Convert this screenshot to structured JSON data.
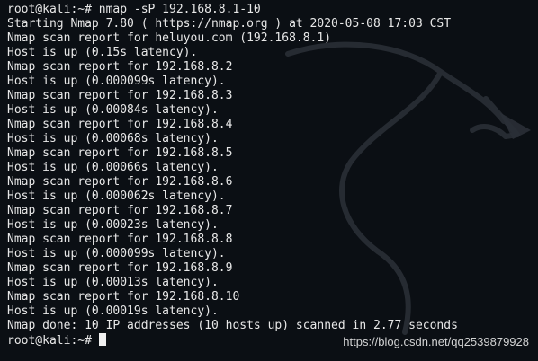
{
  "terminal": {
    "background": "#0b0f14",
    "text_color": "#e8e8e8",
    "lines": [
      "root@kali:~# nmap -sP 192.168.8.1-10",
      "Starting Nmap 7.80 ( https://nmap.org ) at 2020-05-08 17:03 CST",
      "Nmap scan report for heluyou.com (192.168.8.1)",
      "Host is up (0.15s latency).",
      "Nmap scan report for 192.168.8.2",
      "Host is up (0.000099s latency).",
      "Nmap scan report for 192.168.8.3",
      "Host is up (0.00084s latency).",
      "Nmap scan report for 192.168.8.4",
      "Host is up (0.00068s latency).",
      "Nmap scan report for 192.168.8.5",
      "Host is up (0.00066s latency).",
      "Nmap scan report for 192.168.8.6",
      "Host is up (0.000062s latency).",
      "Nmap scan report for 192.168.8.7",
      "Host is up (0.00023s latency).",
      "Nmap scan report for 192.168.8.8",
      "Host is up (0.000099s latency).",
      "Nmap scan report for 192.168.8.9",
      "Host is up (0.00013s latency).",
      "Nmap scan report for 192.168.8.10",
      "Host is up (0.00019s latency).",
      "Nmap done: 10 IP addresses (10 hosts up) scanned in 2.77 seconds"
    ],
    "prompt": "root@kali:~# ",
    "background_logo_icon": "kali-dragon-icon"
  },
  "watermark": {
    "text": "https://blog.csdn.net/qq2539879928"
  }
}
